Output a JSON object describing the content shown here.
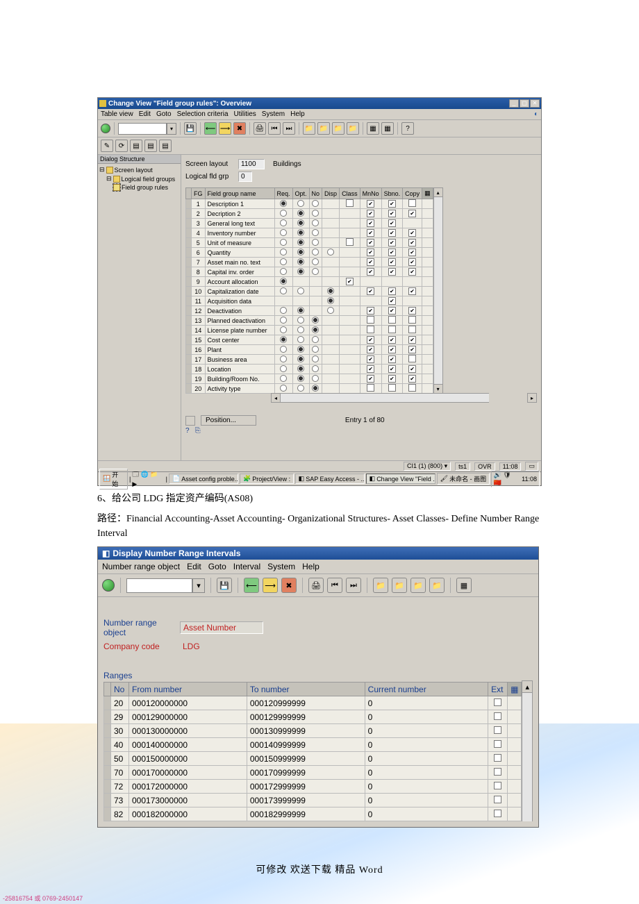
{
  "win1": {
    "title": "Change View \"Field group rules\": Overview",
    "menu": [
      "Table view",
      "Edit",
      "Goto",
      "Selection criteria",
      "Utilities",
      "System",
      "Help"
    ],
    "sidebar_header": "Dialog Structure",
    "tree": {
      "l0": "Screen layout",
      "l1": "Logical field groups",
      "l2": "Field group rules"
    },
    "form": {
      "screen_layout": "1100",
      "screen_layout_txt": "Buildings",
      "logical_grp": "0"
    },
    "grid_headers": [
      "FG",
      "Field group name",
      "Req.",
      "Opt.",
      "No",
      "Disp",
      "Class",
      "MnNo",
      "Sbno.",
      "Copy"
    ],
    "rows": [
      {
        "n": "1",
        "name": "Description 1",
        "req": true,
        "opt": false,
        "no": false,
        "disp": null,
        "cls": false,
        "mn": true,
        "sb": true,
        "cp": false
      },
      {
        "n": "2",
        "name": "Decription 2",
        "req": false,
        "opt": true,
        "no": false,
        "disp": null,
        "cls": null,
        "mn": true,
        "sb": true,
        "cp": true
      },
      {
        "n": "3",
        "name": "General long text",
        "req": false,
        "opt": true,
        "no": false,
        "disp": null,
        "cls": null,
        "mn": true,
        "sb": true,
        "cp": null
      },
      {
        "n": "4",
        "name": "Inventory number",
        "req": false,
        "opt": true,
        "no": false,
        "disp": null,
        "cls": null,
        "mn": true,
        "sb": true,
        "cp": true
      },
      {
        "n": "5",
        "name": "Unit of measure",
        "req": false,
        "opt": true,
        "no": false,
        "disp": null,
        "cls": false,
        "mn": true,
        "sb": true,
        "cp": true
      },
      {
        "n": "6",
        "name": "Quantity",
        "req": false,
        "opt": true,
        "no": false,
        "disp": false,
        "cls": null,
        "mn": true,
        "sb": true,
        "cp": true
      },
      {
        "n": "7",
        "name": "Asset main no. text",
        "req": false,
        "opt": true,
        "no": false,
        "disp": null,
        "cls": null,
        "mn": true,
        "sb": true,
        "cp": true
      },
      {
        "n": "8",
        "name": "Capital inv. order",
        "req": false,
        "opt": true,
        "no": false,
        "disp": null,
        "cls": null,
        "mn": true,
        "sb": true,
        "cp": true
      },
      {
        "n": "9",
        "name": "Account allocation",
        "req": true,
        "opt": null,
        "no": null,
        "disp": null,
        "cls": true,
        "mn": null,
        "sb": null,
        "cp": null
      },
      {
        "n": "10",
        "name": "Capitalization date",
        "req": false,
        "opt": false,
        "no": null,
        "disp": true,
        "cls": null,
        "mn": true,
        "sb": true,
        "cp": true
      },
      {
        "n": "11",
        "name": "Acquisition data",
        "req": null,
        "opt": null,
        "no": null,
        "disp": true,
        "cls": null,
        "mn": null,
        "sb": true,
        "cp": null
      },
      {
        "n": "12",
        "name": "Deactivation",
        "req": false,
        "opt": true,
        "no": null,
        "disp": false,
        "cls": null,
        "mn": true,
        "sb": true,
        "cp": true
      },
      {
        "n": "13",
        "name": "Planned deactivation",
        "req": false,
        "opt": false,
        "no": true,
        "disp": null,
        "cls": null,
        "mn": false,
        "sb": false,
        "cp": false
      },
      {
        "n": "14",
        "name": "License plate number",
        "req": false,
        "opt": false,
        "no": true,
        "disp": null,
        "cls": null,
        "mn": false,
        "sb": false,
        "cp": false
      },
      {
        "n": "15",
        "name": "Cost center",
        "req": true,
        "opt": false,
        "no": false,
        "disp": null,
        "cls": null,
        "mn": true,
        "sb": true,
        "cp": true
      },
      {
        "n": "16",
        "name": "Plant",
        "req": false,
        "opt": true,
        "no": false,
        "disp": null,
        "cls": null,
        "mn": true,
        "sb": true,
        "cp": true
      },
      {
        "n": "17",
        "name": "Business area",
        "req": false,
        "opt": true,
        "no": false,
        "disp": null,
        "cls": null,
        "mn": true,
        "sb": true,
        "cp": false
      },
      {
        "n": "18",
        "name": "Location",
        "req": false,
        "opt": true,
        "no": false,
        "disp": null,
        "cls": null,
        "mn": true,
        "sb": true,
        "cp": true
      },
      {
        "n": "19",
        "name": "Building/Room No.",
        "req": false,
        "opt": true,
        "no": false,
        "disp": null,
        "cls": null,
        "mn": true,
        "sb": true,
        "cp": true
      },
      {
        "n": "20",
        "name": "Activity type",
        "req": false,
        "opt": false,
        "no": true,
        "disp": null,
        "cls": null,
        "mn": false,
        "sb": false,
        "cp": false
      }
    ],
    "position_btn": "Position...",
    "entry_text": "Entry 1 of 80",
    "side_note": "-25816754 或 0769-2450147",
    "status": {
      "s1": "CI1 (1) (800) ▾",
      "s2": "ts1",
      "s3": "OVR",
      "s4": "11:08"
    },
    "taskbar": {
      "start": "开始",
      "items": [
        "Asset config proble...",
        "Project/View :",
        "SAP Easy Access - ...",
        "Change View \"Field ..."
      ],
      "tray": "未命名 - 画图",
      "time": "11:08"
    }
  },
  "para1": "6、给公司 LDG 指定资产编码(AS08)",
  "para2": "路径：Financial Accounting-Asset Accounting- Organizational Structures- Asset Classes- Define Number Range Interval",
  "win2": {
    "title": "Display Number Range Intervals",
    "menu": [
      "Number range object",
      "Edit",
      "Goto",
      "Interval",
      "System",
      "Help"
    ],
    "nr_label": "Number range object",
    "nr_value": "Asset Number",
    "cc_label": "Company code",
    "cc_value": "LDG",
    "ranges_label": "Ranges",
    "headers": [
      "No",
      "From number",
      "To number",
      "Current number",
      "Ext"
    ],
    "rows": [
      {
        "no": "20",
        "from": "000120000000",
        "to": "000120999999",
        "cur": "0",
        "ext": false
      },
      {
        "no": "29",
        "from": "000129000000",
        "to": "000129999999",
        "cur": "0",
        "ext": false
      },
      {
        "no": "30",
        "from": "000130000000",
        "to": "000130999999",
        "cur": "0",
        "ext": false
      },
      {
        "no": "40",
        "from": "000140000000",
        "to": "000140999999",
        "cur": "0",
        "ext": false
      },
      {
        "no": "50",
        "from": "000150000000",
        "to": "000150999999",
        "cur": "0",
        "ext": false
      },
      {
        "no": "70",
        "from": "000170000000",
        "to": "000170999999",
        "cur": "0",
        "ext": false
      },
      {
        "no": "72",
        "from": "000172000000",
        "to": "000172999999",
        "cur": "0",
        "ext": false
      },
      {
        "no": "73",
        "from": "000173000000",
        "to": "000173999999",
        "cur": "0",
        "ext": false
      },
      {
        "no": "82",
        "from": "000182000000",
        "to": "000182999999",
        "cur": "0",
        "ext": false
      }
    ]
  },
  "footer": "可修改   欢送下载   精品   Word"
}
